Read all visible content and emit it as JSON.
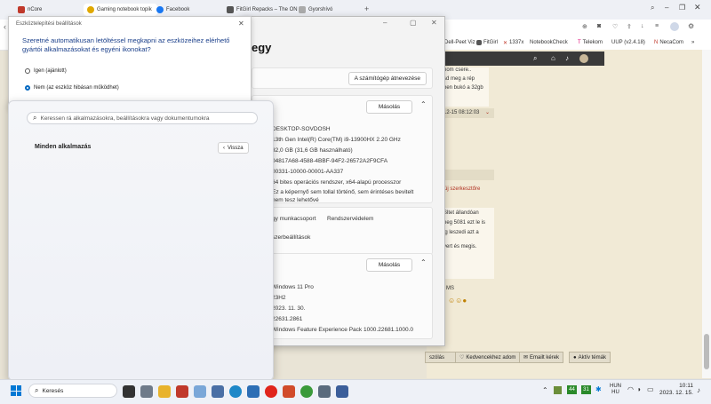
{
  "browser": {
    "tabs": [
      {
        "label": "nCore",
        "color": "#c0392b"
      },
      {
        "label": "Gaming notebook topik",
        "color": "#e0a800"
      },
      {
        "label": "Facebook",
        "color": "#1877f2"
      },
      {
        "label": "FitGirl Repacks – The ON",
        "color": "#555555"
      },
      {
        "label": "Gyorshívó",
        "color": "#888888"
      }
    ],
    "bookmarks": [
      "Dell-Peet Viz",
      "FitGirl",
      "1337x",
      "NotebookCheck",
      "Telekom",
      "UUP (v2.4.18)",
      "NecaCom"
    ]
  },
  "forum": {
    "snippet_lines": [
      "nom csere..",
      "sd meg a rép",
      "ben bukó a 32gb"
    ],
    "post_date": "12-15 08:12:03",
    "edit_label": "új szerkesztőre",
    "body_lines": [
      "Sltet állandóan",
      "neg 5081 ezt le is",
      "ig leszedi azt a",
      "vert és megis."
    ],
    "user_tag": "MS",
    "buttons": [
      "szólás",
      "Kedvencekhez adom",
      "Emailt kérek",
      "Aktív témák"
    ]
  },
  "settings": {
    "title": "egy",
    "rename_button": "A számítógép átnevezése",
    "copy_label": "Másolás",
    "device_specs": [
      "DESKTOP-SOVDOSH",
      "13th Gen Intel(R) Core(TM) i9-13900HX   2.20 GHz",
      "32,0 GB (31,6 GB használható)",
      "04817A68-4588-4BBF-94F2-26572A2F9CFA",
      "00331-10000-00001-AA337",
      "64 bites operációs rendszer, x64-alapú processzor",
      "Ez a képernyő sem tollal történő, sem érintéses bevitelt",
      "nem tesz lehetővé"
    ],
    "links": [
      "gy munkacsoport",
      "Rendszervédelem"
    ],
    "advanced_link": "szerbeállítások",
    "windows_specs": [
      "Windows 11 Pro",
      "23H2",
      "2023. 11. 30.",
      "22631.2861",
      "Windows Feature Experience Pack 1000.22681.1000.0"
    ]
  },
  "dialog": {
    "title": "Eszköztelepítési beállítások",
    "question": "Szeretné automatikusan letöltéssel megkapni az eszközeihez elérhető gyártói alkalmazásokat és egyéni ikonokat?",
    "option_yes": "Igen (ajánlott)",
    "option_no": "Nem (az eszköz hibásan működhet)"
  },
  "start": {
    "search_placeholder": "Keressen rá alkalmazásokra, beállításokra vagy dokumentumokra",
    "all_apps": "Minden alkalmazás",
    "back": "Vissza"
  },
  "taskbar": {
    "search_label": "Keresés",
    "badge_a": "44",
    "badge_b": "31",
    "lang_1": "HUN",
    "lang_2": "HU",
    "time": "10:11",
    "date": "2023. 12. 15."
  },
  "colors": {
    "accent": "#0067c0",
    "forum_bg": "#f1ead6",
    "link": "#b03020"
  }
}
